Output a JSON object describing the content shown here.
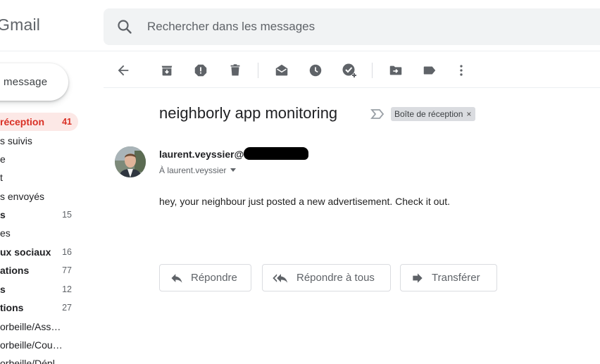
{
  "header": {
    "logo_text": "Gmail",
    "search_placeholder": "Rechercher dans les messages"
  },
  "compose": {
    "label": "message"
  },
  "sidebar": {
    "items": [
      {
        "label": "réception",
        "count": "41",
        "active": true,
        "bold": true
      },
      {
        "label": "s suivis",
        "count": "",
        "bold": false
      },
      {
        "label": "e",
        "count": "",
        "bold": false
      },
      {
        "label": "t",
        "count": "",
        "bold": false
      },
      {
        "label": "s envoyés",
        "count": "",
        "bold": false
      },
      {
        "label": "s",
        "count": "15",
        "bold": true
      },
      {
        "label": "es",
        "count": "",
        "bold": false
      },
      {
        "label": "ux sociaux",
        "count": "16",
        "bold": true
      },
      {
        "label": "ations",
        "count": "77",
        "bold": true
      },
      {
        "label": "s",
        "count": "12",
        "bold": true
      },
      {
        "label": "tions",
        "count": "27",
        "bold": true
      },
      {
        "label": "orbeille/Ass…",
        "count": "",
        "bold": false
      },
      {
        "label": "orbeille/Cou…",
        "count": "",
        "bold": false
      },
      {
        "label": "orbeille/Dépl…",
        "count": "",
        "bold": false
      }
    ]
  },
  "toolbar": {
    "icons": [
      "back-arrow-icon",
      "archive-icon",
      "report-spam-icon",
      "delete-icon",
      "mark-unread-icon",
      "snooze-icon",
      "add-task-icon",
      "move-to-icon",
      "label-icon",
      "more-vert-icon"
    ]
  },
  "message": {
    "subject": "neighborly app monitoring",
    "label_chip": "Boîte de réception",
    "label_chip_close": "×",
    "sender": "laurent.veyssier@",
    "to": "À laurent.veyssier",
    "body": "hey, your neighbour just posted a new advertisement. Check it out."
  },
  "actions": {
    "reply": "Répondre",
    "reply_all": "Répondre à tous",
    "forward": "Transférer"
  },
  "colors": {
    "accent_red": "#d93025",
    "active_bg": "#fce8e6",
    "icon_gray": "#5f6368",
    "search_bg": "#f1f3f4"
  }
}
